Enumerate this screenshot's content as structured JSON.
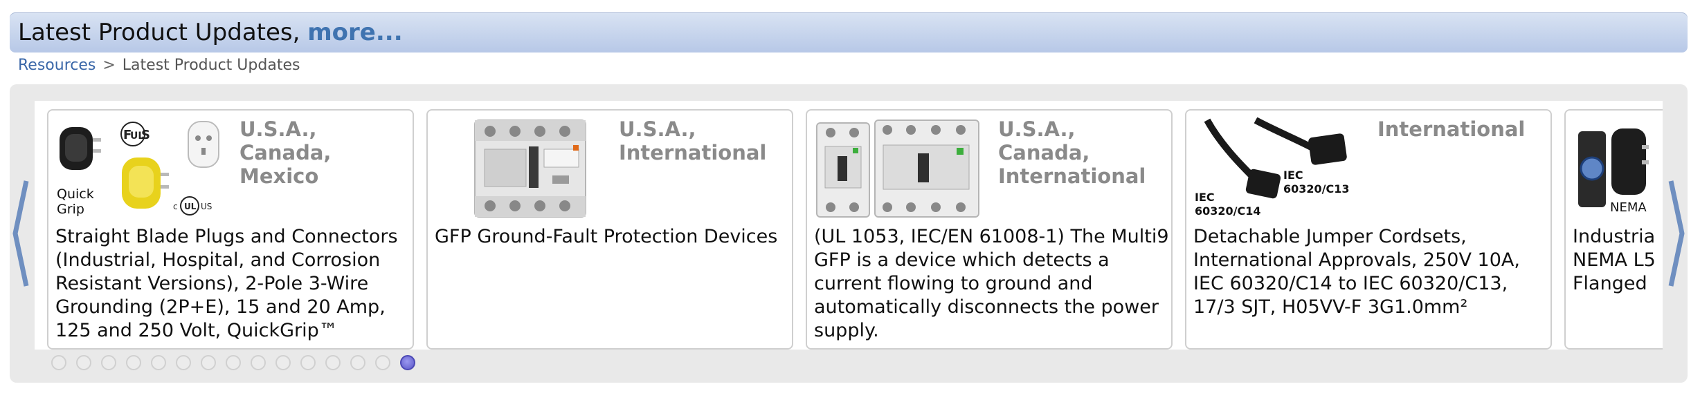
{
  "header": {
    "title": "Latest Product Updates,",
    "more_link": "more..."
  },
  "breadcrumb": {
    "link": "Resources",
    "separator": ">",
    "current": "Latest Product Updates"
  },
  "cards": [
    {
      "region": "U.S.A., Canada, Mexico",
      "description": "Straight Blade Plugs and Connectors (Industrial, Hospital, and Corrosion Resistant Versions), 2-Pole 3-Wire Grounding (2P+E), 15 and 20 Amp, 125 and 250 Volt, QuickGrip™",
      "image_labels": {
        "brand": "Quick Grip"
      }
    },
    {
      "region": "U.S.A., International",
      "description": "GFP Ground-Fault Protection Devices"
    },
    {
      "region": "U.S.A., Canada, International",
      "description": "(UL 1053, IEC/EN 61008-1) The Multi9 GFP is a device which detects a current flowing to ground and automatically disconnects the power supply."
    },
    {
      "region": "International",
      "description": "Detachable Jumper Cordsets, International Approvals, 250V 10A, IEC 60320/C14 to IEC 60320/C13, 17/3 SJT, H05VV-F 3G1.0mm²",
      "image_labels": {
        "left": "IEC 60320/C14",
        "right": "IEC 60320/C13"
      }
    },
    {
      "region": "",
      "description": "Industria NEMA L5 Flanged",
      "image_labels": {
        "brand": "NEMA"
      }
    }
  ],
  "pagination": {
    "total": 15,
    "active_index": 14
  },
  "colors": {
    "accent_link": "#3f73b0",
    "region_text": "#8a8a8a",
    "header_gradient_top": "#d9e3f3",
    "header_gradient_bottom": "#b7c8e7",
    "active_dot": "#5b57c8"
  },
  "icons": {
    "prev": "chevron-left-icon",
    "next": "chevron-right-icon"
  }
}
